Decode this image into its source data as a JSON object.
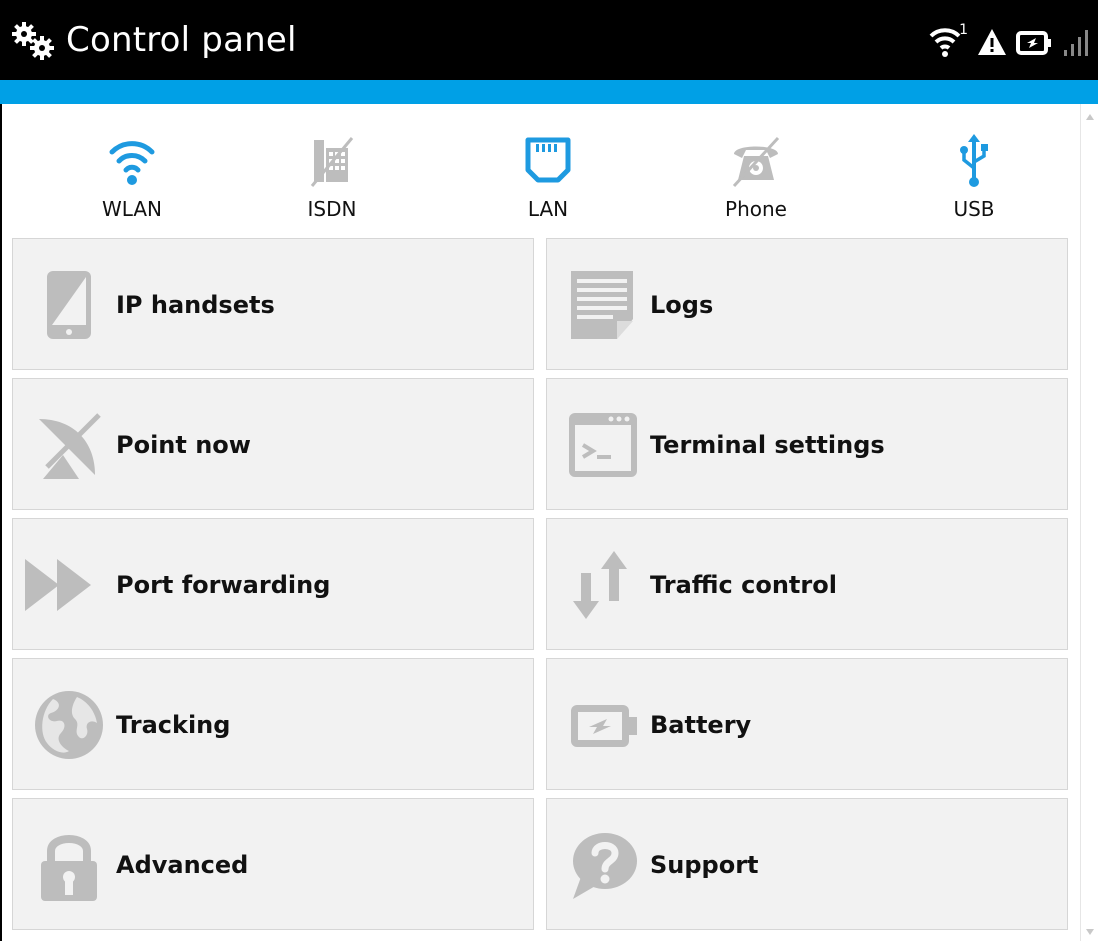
{
  "header": {
    "title": "Control panel",
    "logo_icon": "gears-icon",
    "status": {
      "wifi_count": "1"
    }
  },
  "colors": {
    "accent": "#00a0e6",
    "icon_blue": "#1e9ae0",
    "icon_gray": "#bdbdbd",
    "tile_bg": "#f2f2f2"
  },
  "interfaces": [
    {
      "label": "WLAN",
      "icon": "wifi-icon",
      "active": true
    },
    {
      "label": "ISDN",
      "icon": "isdn-icon",
      "active": false
    },
    {
      "label": "LAN",
      "icon": "lan-icon",
      "active": true
    },
    {
      "label": "Phone",
      "icon": "phone-icon",
      "active": false
    },
    {
      "label": "USB",
      "icon": "usb-icon",
      "active": true
    }
  ],
  "tiles": [
    {
      "label": "IP handsets",
      "icon": "handset-icon"
    },
    {
      "label": "Logs",
      "icon": "logs-icon"
    },
    {
      "label": "Point now",
      "icon": "satellite-dish-icon"
    },
    {
      "label": "Terminal settings",
      "icon": "terminal-icon"
    },
    {
      "label": "Port forwarding",
      "icon": "fast-forward-icon"
    },
    {
      "label": "Traffic control",
      "icon": "traffic-arrows-icon"
    },
    {
      "label": "Tracking",
      "icon": "globe-icon"
    },
    {
      "label": "Battery",
      "icon": "battery-icon"
    },
    {
      "label": "Advanced",
      "icon": "lock-icon"
    },
    {
      "label": "Support",
      "icon": "help-bubble-icon"
    }
  ]
}
